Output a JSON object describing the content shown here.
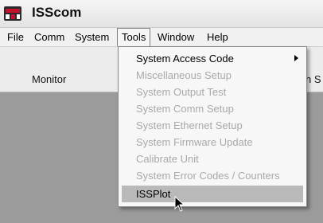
{
  "window": {
    "title": "ISScom"
  },
  "menubar": {
    "items": [
      {
        "label": "File"
      },
      {
        "label": "Comm"
      },
      {
        "label": "System"
      },
      {
        "label": "Tools"
      },
      {
        "label": "Window"
      },
      {
        "label": "Help"
      }
    ],
    "active_item": "Tools"
  },
  "toolbar": {
    "monitor_label": "Monitor",
    "partial_label": "n S"
  },
  "tools_menu": {
    "items": [
      {
        "label": "System Access Code",
        "enabled": true,
        "has_submenu": true
      },
      {
        "label": "Miscellaneous Setup",
        "enabled": false
      },
      {
        "label": "System Output Test",
        "enabled": false
      },
      {
        "label": "System Comm Setup",
        "enabled": false
      },
      {
        "label": "System Ethernet Setup",
        "enabled": false
      },
      {
        "label": "System Firmware Update",
        "enabled": false
      },
      {
        "label": "Calibrate Unit",
        "enabled": false
      },
      {
        "label": "System Error Codes / Counters",
        "enabled": false
      },
      {
        "label": "ISSPlot",
        "enabled": true,
        "hovered": true
      }
    ]
  },
  "icons": {
    "app": "issc-app-icon",
    "submenu_arrow": "chevron-right-icon",
    "cursor": "mouse-pointer-icon"
  },
  "colors": {
    "client_background": "#9b9b9b",
    "menu_background": "#f7f7f7",
    "hover_highlight": "#b9b9b9",
    "disabled_text": "#a9a9a9"
  }
}
